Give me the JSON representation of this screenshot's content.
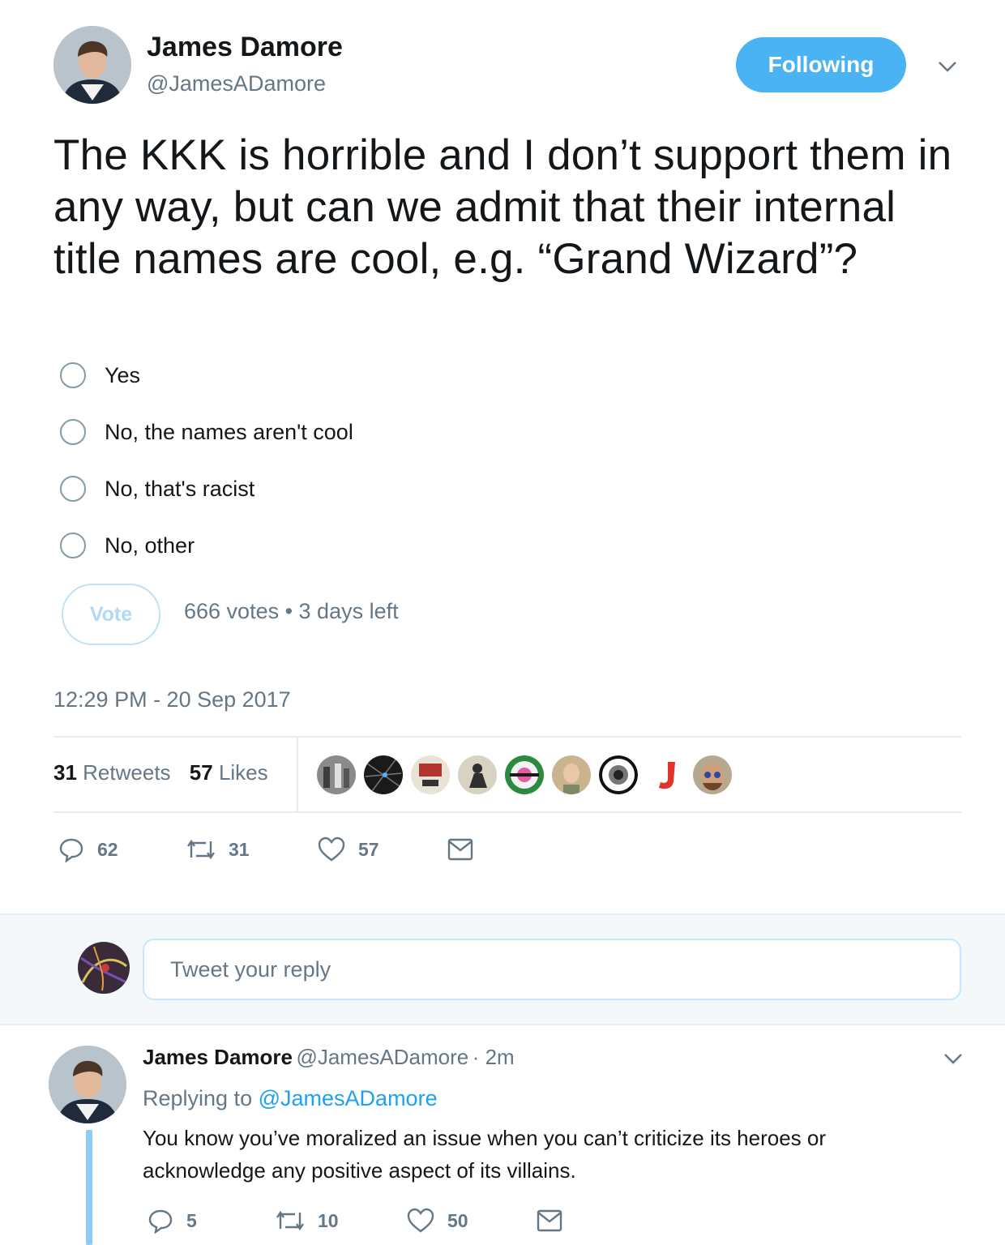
{
  "author": {
    "name": "James Damore",
    "handle": "@JamesADamore",
    "follow_label": "Following"
  },
  "tweet": {
    "text": "The KKK is horrible and I don’t support them in any way, but can we admit that their internal title names are cool, e.g. “Grand Wizard”?",
    "poll": {
      "options": [
        "Yes",
        "No, the names aren't cool",
        "No, that's racist",
        "No, other"
      ],
      "vote_label": "Vote",
      "meta": "666 votes • 3 days left"
    },
    "timestamp": "12:29 PM - 20 Sep 2017",
    "retweets_count": "31",
    "retweets_label": "Retweets",
    "likes_count": "57",
    "likes_label": "Likes",
    "actions": {
      "replies": "62",
      "retweets": "31",
      "likes": "57"
    }
  },
  "reply_box": {
    "placeholder": "Tweet your reply"
  },
  "reply": {
    "name": "James Damore",
    "handle": "@JamesADamore",
    "time": "· 2m",
    "replying_prefix": "Replying to",
    "replying_handle": "@JamesADamore",
    "text": "You know you’ve moralized an issue when you can’t criticize its heroes or acknowledge any positive aspect of its villains.",
    "actions": {
      "replies": "5",
      "retweets": "10",
      "likes": "50"
    }
  },
  "colors": {
    "accent": "#1da1f2",
    "follow_button": "#4ab3f4",
    "muted_text": "#657786",
    "thread_line": "#8ecbf6"
  }
}
